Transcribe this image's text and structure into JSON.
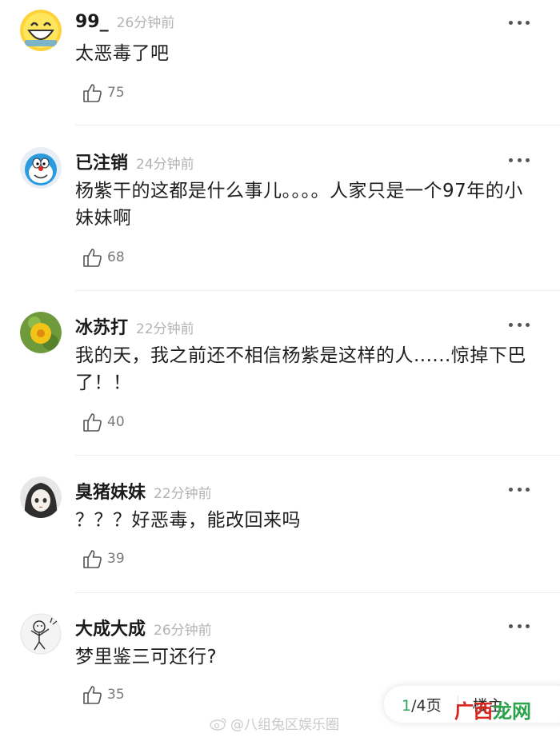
{
  "comments": [
    {
      "username": "99_",
      "time": "26分钟前",
      "text": "太恶毒了吧",
      "likes": "75",
      "avatar": "laughing-face-avatar"
    },
    {
      "username": "已注销",
      "time": "24分钟前",
      "text": "杨紫干的这都是什么事儿。。。。人家只是一个97年的小妹妹啊",
      "likes": "68",
      "avatar": "doraemon-avatar"
    },
    {
      "username": "冰苏打",
      "time": "22分钟前",
      "text": "我的天，我之前还不相信杨紫是这样的人......惊掉下巴了！！",
      "likes": "40",
      "avatar": "yellow-flower-avatar"
    },
    {
      "username": "臭猪妹妹",
      "time": "22分钟前",
      "text": "？？？好恶毒，能改回来吗",
      "likes": "39",
      "avatar": "anime-girl-avatar"
    },
    {
      "username": "大成大成",
      "time": "26分钟前",
      "text": "梦里鉴三可还行?",
      "likes": "35",
      "avatar": "doodle-character-avatar"
    }
  ],
  "pager": {
    "current": "1",
    "total": "/4页",
    "floor": "楼主"
  },
  "watermark": {
    "text": "@八组兔区娱乐圈"
  },
  "site_mark": {
    "part1": "广西",
    "part2": "龙网"
  },
  "colors": {
    "accent": "#2fa35a",
    "site_red": "#d9261c",
    "site_green": "#2aa34a"
  }
}
